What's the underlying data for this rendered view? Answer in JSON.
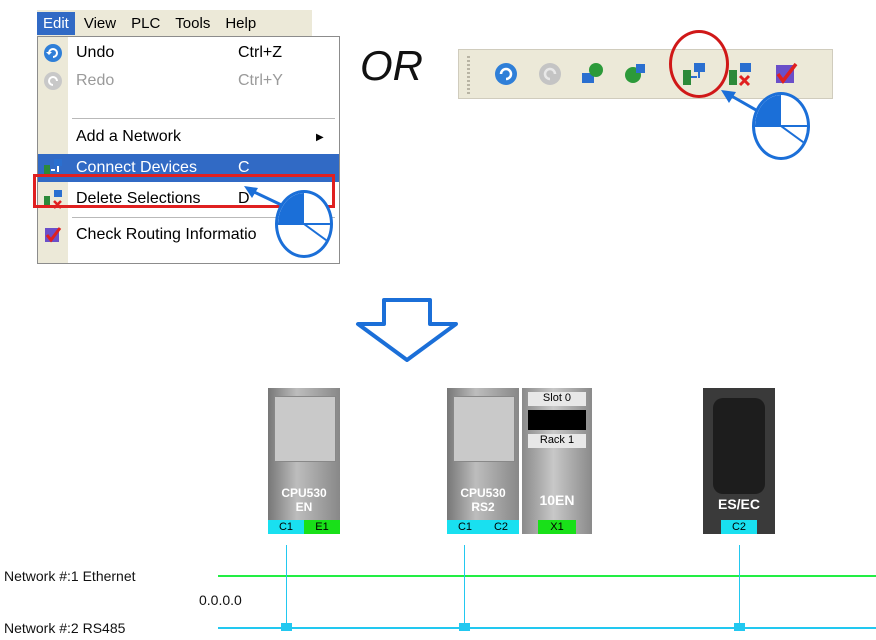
{
  "menubar": {
    "items": [
      "Edit",
      "View",
      "PLC",
      "Tools",
      "Help"
    ]
  },
  "edit_menu": {
    "undo": {
      "label": "Undo",
      "shortcut": "Ctrl+Z"
    },
    "redo": {
      "label": "Redo",
      "shortcut": "Ctrl+Y"
    },
    "add_network": {
      "label": "Add a Network"
    },
    "connect_devices": {
      "label": "Connect Devices",
      "shortcut": "C"
    },
    "delete_selections": {
      "label": "Delete Selections",
      "shortcut": "D"
    },
    "check_routing": {
      "label": "Check Routing Informatio"
    }
  },
  "or_label": "OR",
  "toolbar": {
    "buttons": [
      "undo-icon",
      "redo-icon",
      "upload-icon",
      "download-icon",
      "connect-devices-icon",
      "delete-selections-icon",
      "check-routing-icon"
    ]
  },
  "diagram": {
    "devices": [
      {
        "name": "CPU530",
        "sub": "EN",
        "ports": [
          "C1",
          "E1"
        ]
      },
      {
        "name": "CPU530",
        "sub": "RS2",
        "ports": [
          "C1",
          "C2"
        ]
      },
      {
        "slot": "Slot 0",
        "rack": "Rack 1",
        "name": "10EN",
        "ports": [
          "X1"
        ]
      },
      {
        "name": "ES/EC",
        "ports": [
          "C2"
        ]
      }
    ],
    "networks": [
      {
        "label": "Network #:1  Ethernet",
        "address": "0.0.0.0"
      },
      {
        "label": "Network #:2  RS485"
      }
    ]
  },
  "colors": {
    "highlight": "#316ac5",
    "callout_red": "#e02020",
    "mouse_blue": "#1b6fd8",
    "ethernet_line": "#22ee44",
    "rs485_line": "#22c8f0",
    "port_cyan": "#19e0f0",
    "port_green": "#19e019"
  }
}
